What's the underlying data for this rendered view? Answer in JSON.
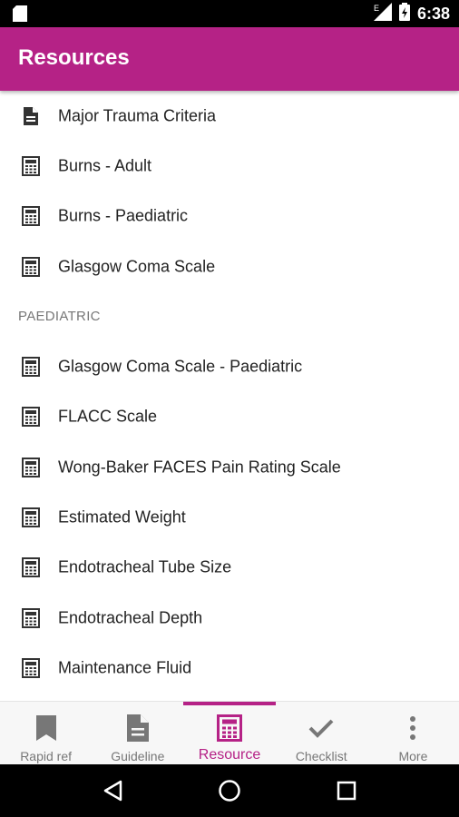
{
  "status_bar": {
    "time": "6:38",
    "signal_label": "E"
  },
  "app_bar": {
    "title": "Resources"
  },
  "list": {
    "items": [
      {
        "label": "Major Trauma Criteria",
        "icon": "document-icon"
      },
      {
        "label": "Burns - Adult",
        "icon": "calculator-icon"
      },
      {
        "label": "Burns - Paediatric",
        "icon": "calculator-icon"
      },
      {
        "label": "Glasgow Coma Scale",
        "icon": "calculator-icon"
      }
    ],
    "section_header": "PAEDIATRIC",
    "paediatric_items": [
      {
        "label": "Glasgow Coma Scale - Paediatric",
        "icon": "calculator-icon"
      },
      {
        "label": "FLACC Scale",
        "icon": "calculator-icon"
      },
      {
        "label": "Wong-Baker FACES Pain Rating Scale",
        "icon": "calculator-icon"
      },
      {
        "label": "Estimated Weight",
        "icon": "calculator-icon"
      },
      {
        "label": "Endotracheal Tube Size",
        "icon": "calculator-icon"
      },
      {
        "label": "Endotracheal Depth",
        "icon": "calculator-icon"
      },
      {
        "label": "Maintenance Fluid",
        "icon": "calculator-icon"
      }
    ]
  },
  "bottom_nav": {
    "tabs": [
      {
        "label": "Rapid ref",
        "icon": "bookmark-icon"
      },
      {
        "label": "Guideline",
        "icon": "document-icon"
      },
      {
        "label": "Resource",
        "icon": "calculator-icon"
      },
      {
        "label": "Checklist",
        "icon": "check-icon"
      },
      {
        "label": "More",
        "icon": "more-vertical-icon"
      }
    ],
    "active": "Resource"
  },
  "colors": {
    "accent": "#b52286",
    "icon": "#333333",
    "inactive": "#777777"
  }
}
